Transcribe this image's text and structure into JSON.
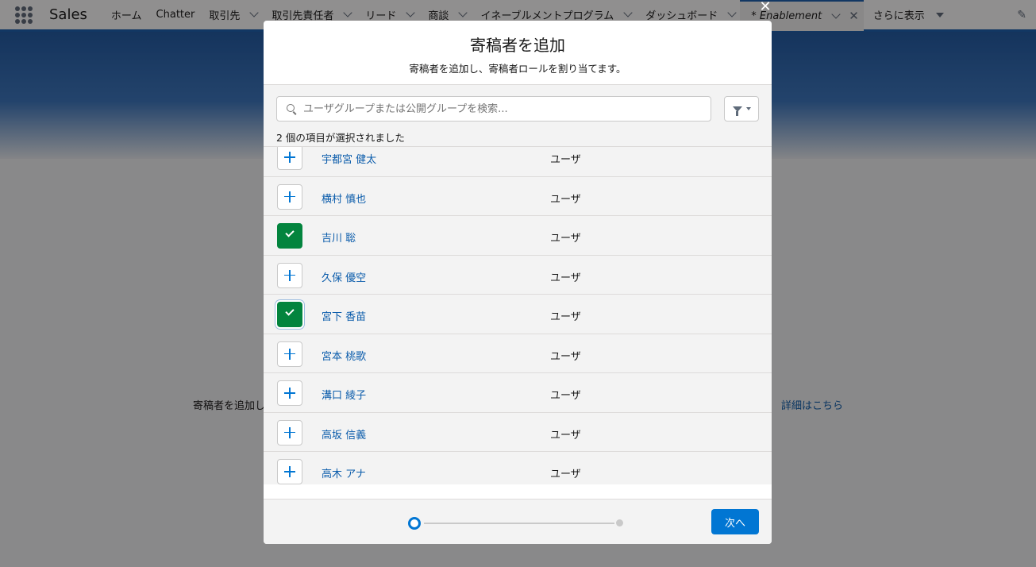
{
  "nav": {
    "app_name": "Sales",
    "items": [
      {
        "label": "ホーム",
        "chevron": false
      },
      {
        "label": "Chatter",
        "chevron": false
      },
      {
        "label": "取引先",
        "chevron": true
      },
      {
        "label": "取引先責任者",
        "chevron": true
      },
      {
        "label": "リード",
        "chevron": true
      },
      {
        "label": "商談",
        "chevron": true
      },
      {
        "label": "イネーブルメントプログラム",
        "chevron": true
      },
      {
        "label": "ダッシュボード",
        "chevron": true
      }
    ],
    "active_tab": "* Enablement",
    "more_label": "さらに表示"
  },
  "background": {
    "text": "寄稿者を追加し",
    "link": "詳細はこちら"
  },
  "modal": {
    "title": "寄稿者を追加",
    "subtitle": "寄稿者を追加し、寄稿者ロールを割り当てます。",
    "search_placeholder": "ユーザグループまたは公開グループを検索...",
    "selected_count": "2 個の項目が選択されました",
    "rows": [
      {
        "name": "宇都宮 健太",
        "type": "ユーザ",
        "selected": false
      },
      {
        "name": "横村 慎也",
        "type": "ユーザ",
        "selected": false
      },
      {
        "name": "吉川 聡",
        "type": "ユーザ",
        "selected": true
      },
      {
        "name": "久保 優空",
        "type": "ユーザ",
        "selected": false
      },
      {
        "name": "宮下 香苗",
        "type": "ユーザ",
        "selected": true
      },
      {
        "name": "宮本 桃歌",
        "type": "ユーザ",
        "selected": false
      },
      {
        "name": "溝口 綾子",
        "type": "ユーザ",
        "selected": false
      },
      {
        "name": "高坂 信義",
        "type": "ユーザ",
        "selected": false
      },
      {
        "name": "高木 アナ",
        "type": "ユーザ",
        "selected": false
      }
    ],
    "next_label": "次へ",
    "progress": {
      "current_step": 1,
      "total_steps": 2
    }
  },
  "colors": {
    "brand": "#0176d3",
    "link": "#0b5cab",
    "selected": "#03843e"
  }
}
